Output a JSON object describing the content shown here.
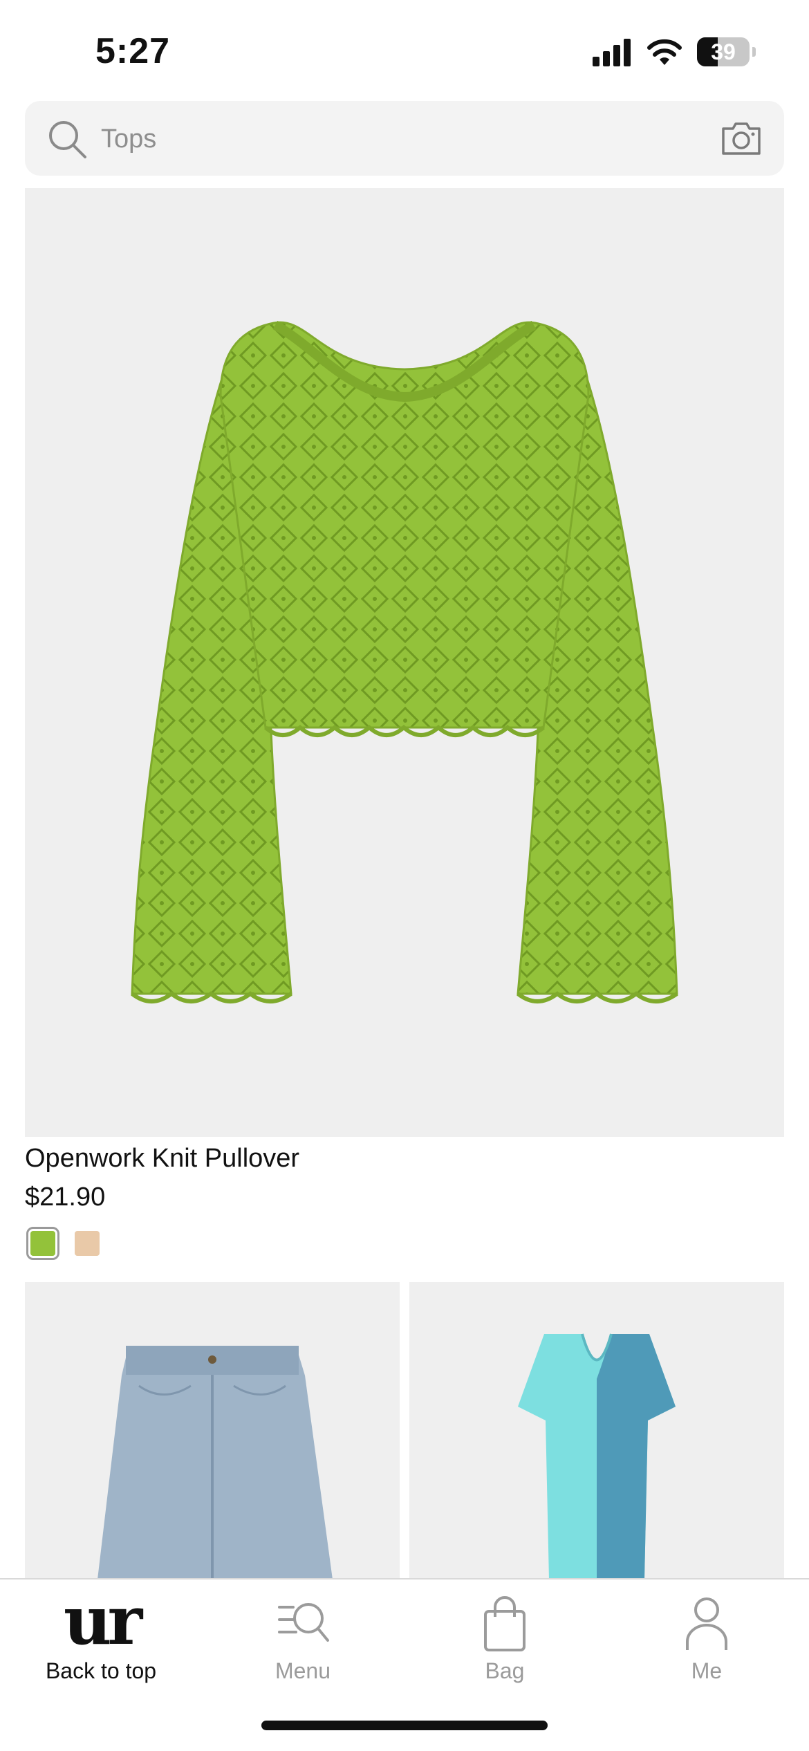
{
  "status_bar": {
    "time": "5:27",
    "battery_level": "39",
    "battery_fraction": 0.39,
    "icons": [
      "cellular-signal-icon",
      "wifi-icon",
      "battery-icon"
    ]
  },
  "search": {
    "placeholder": "Tops",
    "icons": [
      "search-icon",
      "camera-icon"
    ]
  },
  "featured_product": {
    "name": "Openwork Knit Pullover",
    "price": "$21.90",
    "color_swatches": [
      {
        "color": "#93c23a",
        "selected": true
      },
      {
        "color": "#e9c9a8",
        "selected": false
      }
    ]
  },
  "product_grid": [
    {
      "image": "light-wash-wide-leg-jeans"
    },
    {
      "image": "two-tone-blue-tshirt-dress"
    }
  ],
  "tab_bar": {
    "tabs": [
      {
        "label": "Back to top",
        "icon": "ur-logo",
        "active": true
      },
      {
        "label": "Menu",
        "icon": "menu-search-icon",
        "active": false
      },
      {
        "label": "Bag",
        "icon": "bag-icon",
        "active": false
      },
      {
        "label": "Me",
        "icon": "person-icon",
        "active": false
      }
    ],
    "logo_text": "ur"
  },
  "colors": {
    "active_text": "#111111",
    "inactive_text": "#9b9b9b",
    "search_bg": "#f3f3f3",
    "image_bg": "#efefef"
  }
}
